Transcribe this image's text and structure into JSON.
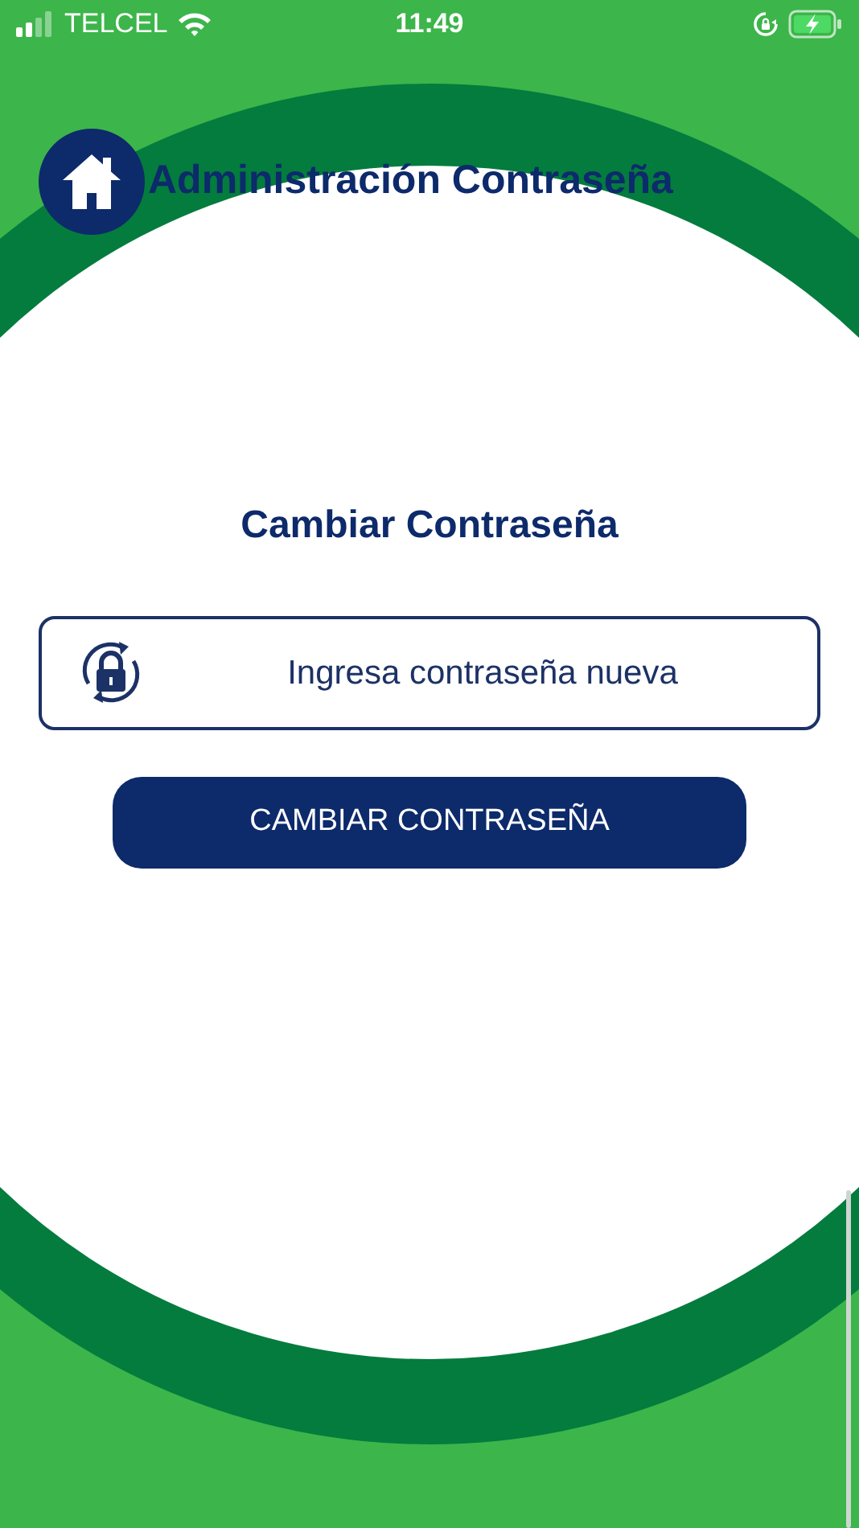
{
  "status_bar": {
    "carrier": "TELCEL",
    "time": "11:49"
  },
  "header": {
    "title": "Administración Contraseña"
  },
  "form": {
    "heading": "Cambiar Contraseña",
    "password_field": {
      "placeholder": "Ingresa contraseña nueva"
    },
    "submit_button": "CAMBIAR CONTRASEÑA"
  }
}
